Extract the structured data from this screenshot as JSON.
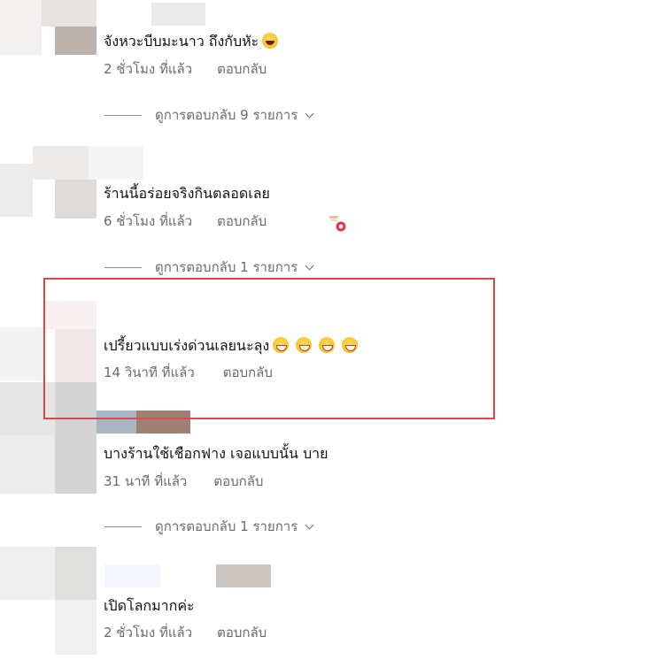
{
  "comments": [
    {
      "text": "จังหวะบีบมะนาว ถึงกับหัะ",
      "emoji": "laughing-face",
      "time": "2 ชั่วโมง ที่แล้ว",
      "reply": "ตอบกลับ",
      "view_replies": "ดูการตอบกลับ 9 รายการ"
    },
    {
      "text": "ร้านนี้อร่อยจริงกินตลอดเลย",
      "time": "6 ชั่วโมง ที่แล้ว",
      "reply": "ตอบกลับ",
      "reaction_icon": "reaction-heart-icon",
      "view_replies": "ดูการตอบกลับ 1 รายการ"
    },
    {
      "text": "เปรี้ยวแบบเร่งด่วนเลยนะลุง",
      "emoji": "grinning-face x4",
      "time": "14 วินาที ที่แล้ว",
      "reply": "ตอบกลับ",
      "highlighted": true,
      "highlight_color": "#e0474a"
    },
    {
      "text": "บางร้านใช้เชือกฟาง เจอแบบนั้น บาย",
      "time": "31 นาที ที่แล้ว",
      "reply": "ตอบกลับ",
      "view_replies": "ดูการตอบกลับ 1 รายการ"
    },
    {
      "text": "เปิดโลกมากค่ะ",
      "time": "2 ชั่วโมง ที่แล้ว",
      "reply": "ตอบกลับ"
    }
  ]
}
